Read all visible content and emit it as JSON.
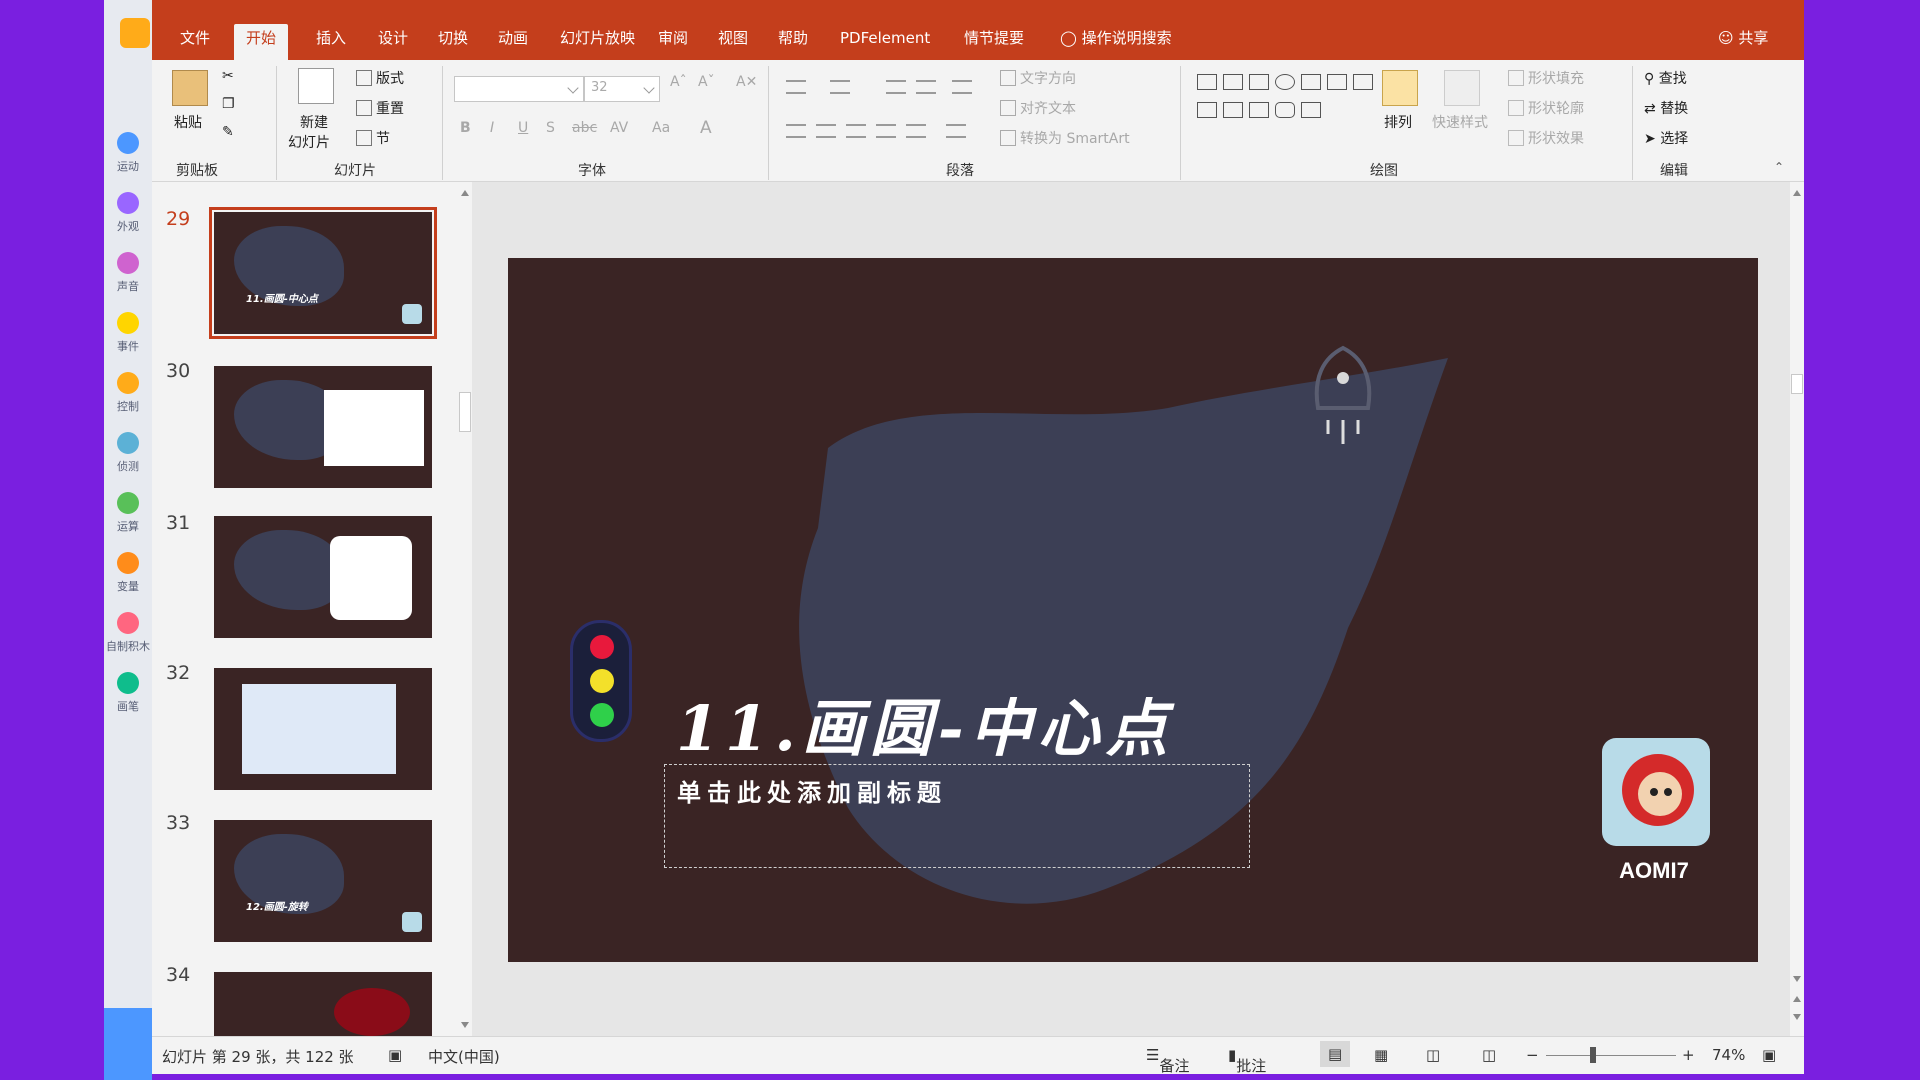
{
  "scratch": {
    "categories": [
      {
        "label": "运动",
        "color": "#4c97ff"
      },
      {
        "label": "外观",
        "color": "#9966ff"
      },
      {
        "label": "声音",
        "color": "#cf63cf"
      },
      {
        "label": "事件",
        "color": "#ffd500"
      },
      {
        "label": "控制",
        "color": "#ffab19"
      },
      {
        "label": "侦测",
        "color": "#5cb1d6"
      },
      {
        "label": "运算",
        "color": "#59c059"
      },
      {
        "label": "变量",
        "color": "#ff8c1a"
      },
      {
        "label": "自制积木",
        "color": "#ff6680"
      },
      {
        "label": "画笔",
        "color": "#0fbd8c"
      }
    ]
  },
  "ribbon": {
    "tabs": [
      "文件",
      "开始",
      "插入",
      "设计",
      "切换",
      "动画",
      "幻灯片放映",
      "审阅",
      "视图",
      "帮助",
      "PDFelement",
      "情节提要"
    ],
    "active_tab": "开始",
    "tell_me": "操作说明搜索",
    "share": "共享",
    "clipboard": {
      "paste": "粘贴",
      "group": "剪贴板"
    },
    "slides": {
      "new_slide": "新建",
      "new_slide_2": "幻灯片",
      "layout": "版式",
      "reset": "重置",
      "section": "节",
      "group": "幻灯片"
    },
    "font": {
      "size": "32",
      "group": "字体"
    },
    "paragraph": {
      "text_direction": "文字方向",
      "align_text": "对齐文本",
      "smartart": "转换为 SmartArt",
      "group": "段落"
    },
    "drawing": {
      "arrange": "排列",
      "quick_styles": "快速样式",
      "fill": "形状填充",
      "outline": "形状轮廓",
      "effects": "形状效果",
      "group": "绘图"
    },
    "editing": {
      "find": "查找",
      "replace": "替换",
      "select": "选择",
      "group": "编辑"
    }
  },
  "thumbnails": [
    {
      "num": "29",
      "title": "11.画圆-中心点",
      "active": true
    },
    {
      "num": "30",
      "title": "",
      "active": false
    },
    {
      "num": "31",
      "title": "",
      "active": false
    },
    {
      "num": "32",
      "title": "",
      "active": false
    },
    {
      "num": "33",
      "title": "12.画圆-旋转",
      "active": false
    },
    {
      "num": "34",
      "title": "",
      "active": false
    }
  ],
  "slide": {
    "title": "11.画圆-中心点",
    "subtitle_placeholder": "单击此处添加副标题",
    "logo_text": "AOMI7",
    "background": "#3a2424",
    "splash_color": "#3c3f55"
  },
  "status": {
    "slide_info": "幻灯片 第 29 张，共 122 张",
    "language": "中文(中国)",
    "notes": "备注",
    "comments": "批注",
    "zoom": "74%"
  }
}
